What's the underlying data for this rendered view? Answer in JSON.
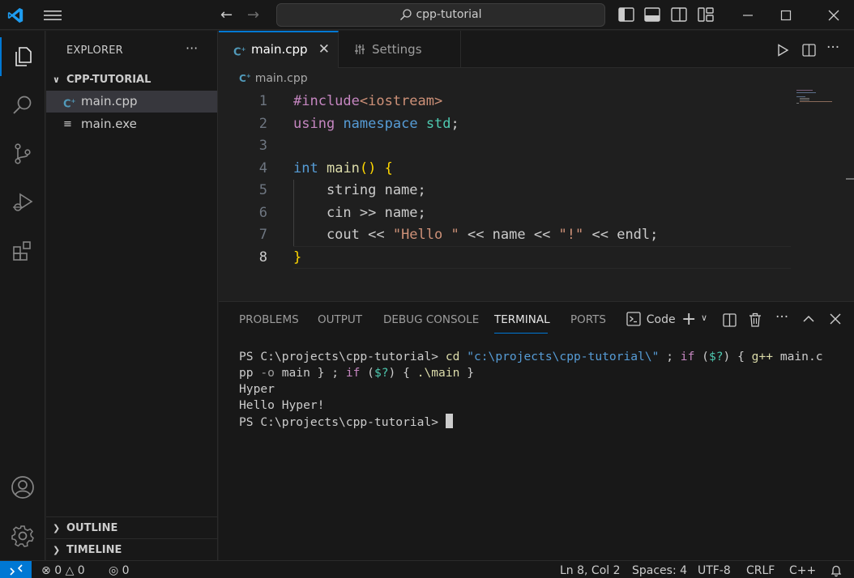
{
  "titlebar": {
    "search_text": "cpp-tutorial"
  },
  "sidebar": {
    "title": "EXPLORER",
    "more": "···",
    "folder": "CPP-TUTORIAL",
    "files": [
      {
        "name": "main.cpp",
        "icon": "cpp-file-icon",
        "selected": true
      },
      {
        "name": "main.exe",
        "icon": "file-lines-icon",
        "selected": false
      }
    ],
    "sections": [
      "OUTLINE",
      "TIMELINE"
    ]
  },
  "tabs": [
    {
      "label": "main.cpp",
      "active": true
    },
    {
      "label": "Settings",
      "active": false
    }
  ],
  "breadcrumb": "main.cpp",
  "code": {
    "line_numbers": [
      "1",
      "2",
      "3",
      "4",
      "5",
      "6",
      "7",
      "8"
    ],
    "current_line": "8",
    "lines": [
      [
        {
          "t": "#include",
          "c": "kw-pre"
        },
        {
          "t": "<iostream>",
          "c": "str"
        }
      ],
      [
        {
          "t": "using",
          "c": "kw-pre"
        },
        {
          "t": " ",
          "c": ""
        },
        {
          "t": "namespace",
          "c": "kw"
        },
        {
          "t": " ",
          "c": ""
        },
        {
          "t": "std",
          "c": "ns"
        },
        {
          "t": ";",
          "c": ""
        }
      ],
      [],
      [
        {
          "t": "int",
          "c": "kw"
        },
        {
          "t": " ",
          "c": ""
        },
        {
          "t": "main",
          "c": "fn"
        },
        {
          "t": "()",
          "c": "br"
        },
        {
          "t": " ",
          "c": ""
        },
        {
          "t": "{",
          "c": "br"
        }
      ],
      [
        {
          "t": "    string name;",
          "c": ""
        }
      ],
      [
        {
          "t": "    cin >> name;",
          "c": ""
        }
      ],
      [
        {
          "t": "    cout << ",
          "c": ""
        },
        {
          "t": "\"Hello \"",
          "c": "str"
        },
        {
          "t": " << name << ",
          "c": ""
        },
        {
          "t": "\"!\"",
          "c": "str"
        },
        {
          "t": " << endl;",
          "c": ""
        }
      ],
      [
        {
          "t": "}",
          "c": "br"
        }
      ]
    ]
  },
  "panel": {
    "tabs": [
      "PROBLEMS",
      "OUTPUT",
      "DEBUG CONSOLE",
      "TERMINAL",
      "PORTS"
    ],
    "active_tab": "TERMINAL",
    "terminal_label": "Code",
    "terminal_lines": [
      [
        {
          "t": "PS C:\\projects\\cpp-tutorial> ",
          "c": ""
        },
        {
          "t": "cd",
          "c": "tcmd"
        },
        {
          "t": " ",
          "c": ""
        },
        {
          "t": "\"c:\\projects\\cpp-tutorial\\\"",
          "c": "tstr"
        },
        {
          "t": " ; ",
          "c": ""
        },
        {
          "t": "if",
          "c": "tkw"
        },
        {
          "t": " (",
          "c": ""
        },
        {
          "t": "$?",
          "c": "tvar"
        },
        {
          "t": ") { ",
          "c": ""
        },
        {
          "t": "g++",
          "c": "tcmd"
        },
        {
          "t": " main.c",
          "c": ""
        }
      ],
      [
        {
          "t": "pp ",
          "c": ""
        },
        {
          "t": "-o",
          "c": "tflag"
        },
        {
          "t": " main } ; ",
          "c": ""
        },
        {
          "t": "if",
          "c": "tkw"
        },
        {
          "t": " (",
          "c": ""
        },
        {
          "t": "$?",
          "c": "tvar"
        },
        {
          "t": ") { ",
          "c": ""
        },
        {
          "t": ".\\main",
          "c": "tcmd"
        },
        {
          "t": " }",
          "c": ""
        }
      ],
      [
        {
          "t": "Hyper",
          "c": ""
        }
      ],
      [
        {
          "t": "Hello Hyper!",
          "c": ""
        }
      ],
      [
        {
          "t": "PS C:\\projects\\cpp-tutorial> ",
          "c": ""
        }
      ]
    ]
  },
  "statusbar": {
    "errors": "0",
    "warnings": "0",
    "ports": "0",
    "position": "Ln 8, Col 2",
    "spaces": "Spaces: 4",
    "encoding": "UTF-8",
    "eol": "CRLF",
    "language": "C++"
  },
  "colors": {
    "accent": "#0078d4",
    "background": "#1f1f1f",
    "chrome": "#181818"
  }
}
